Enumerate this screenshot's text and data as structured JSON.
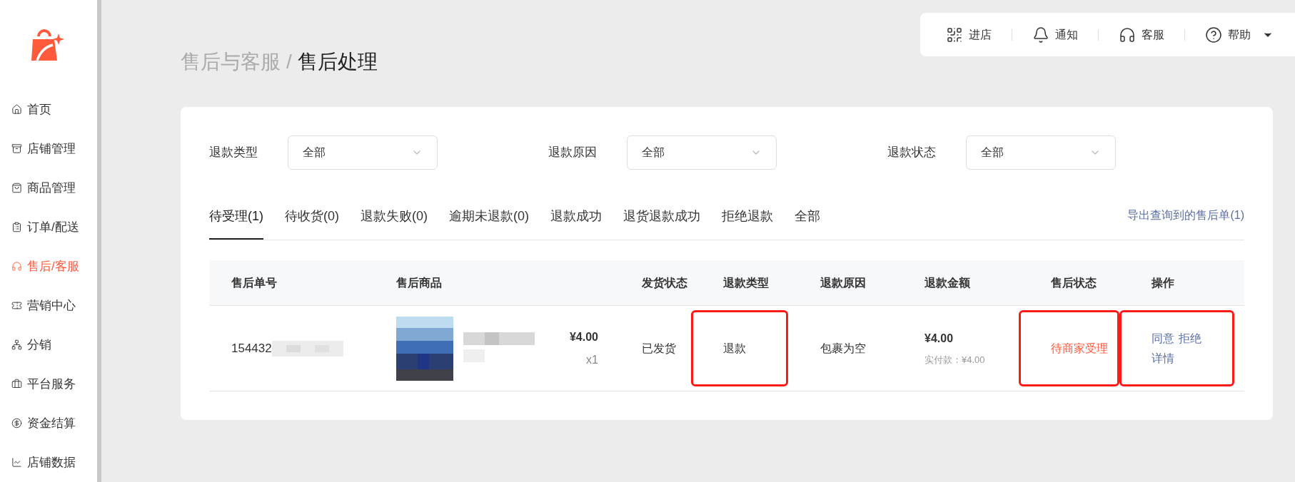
{
  "sidebar": {
    "items": [
      {
        "label": "首页",
        "selected": false
      },
      {
        "label": "店铺管理",
        "selected": false
      },
      {
        "label": "商品管理",
        "selected": false
      },
      {
        "label": "订单/配送",
        "selected": false
      },
      {
        "label": "售后/客服",
        "selected": true
      },
      {
        "label": "营销中心",
        "selected": false
      },
      {
        "label": "分销",
        "selected": false
      },
      {
        "label": "平台服务",
        "selected": false
      },
      {
        "label": "资金结算",
        "selected": false
      },
      {
        "label": "店铺数据",
        "selected": false
      }
    ]
  },
  "topbar": {
    "items": [
      {
        "label": "进店"
      },
      {
        "label": "通知"
      },
      {
        "label": "客服"
      },
      {
        "label": "帮助"
      }
    ]
  },
  "breadcrumb": {
    "parent": "售后与客服",
    "separator": "/",
    "current": "售后处理"
  },
  "filters": [
    {
      "label": "退款类型",
      "value": "全部"
    },
    {
      "label": "退款原因",
      "value": "全部"
    },
    {
      "label": "退款状态",
      "value": "全部"
    }
  ],
  "tabs": [
    {
      "label": "待受理(1)",
      "selected": true
    },
    {
      "label": "待收货(0)",
      "selected": false
    },
    {
      "label": "退款失败(0)",
      "selected": false
    },
    {
      "label": "逾期未退款(0)",
      "selected": false
    },
    {
      "label": "退款成功",
      "selected": false
    },
    {
      "label": "退货退款成功",
      "selected": false
    },
    {
      "label": "拒绝退款",
      "selected": false
    },
    {
      "label": "全部",
      "selected": false
    }
  ],
  "export_link": "导出查询到的售后单(1)",
  "table": {
    "columns": [
      "售后单号",
      "售后商品",
      "发货状态",
      "退款类型",
      "退款原因",
      "退款金额",
      "售后状态",
      "操作"
    ],
    "rows": [
      {
        "order_no": "154432",
        "price": "¥4.00",
        "quantity": "x1",
        "shipping_status": "已发货",
        "refund_type": "退款",
        "refund_reason": "包裹为空",
        "refund_amount": "¥4.00",
        "paid": "实付款：¥4.00",
        "status": "待商家受理",
        "actions": [
          "同意",
          "拒绝",
          "详情"
        ],
        "highlighted": [
          false,
          false,
          false,
          true,
          false,
          false,
          true,
          true
        ]
      }
    ]
  }
}
